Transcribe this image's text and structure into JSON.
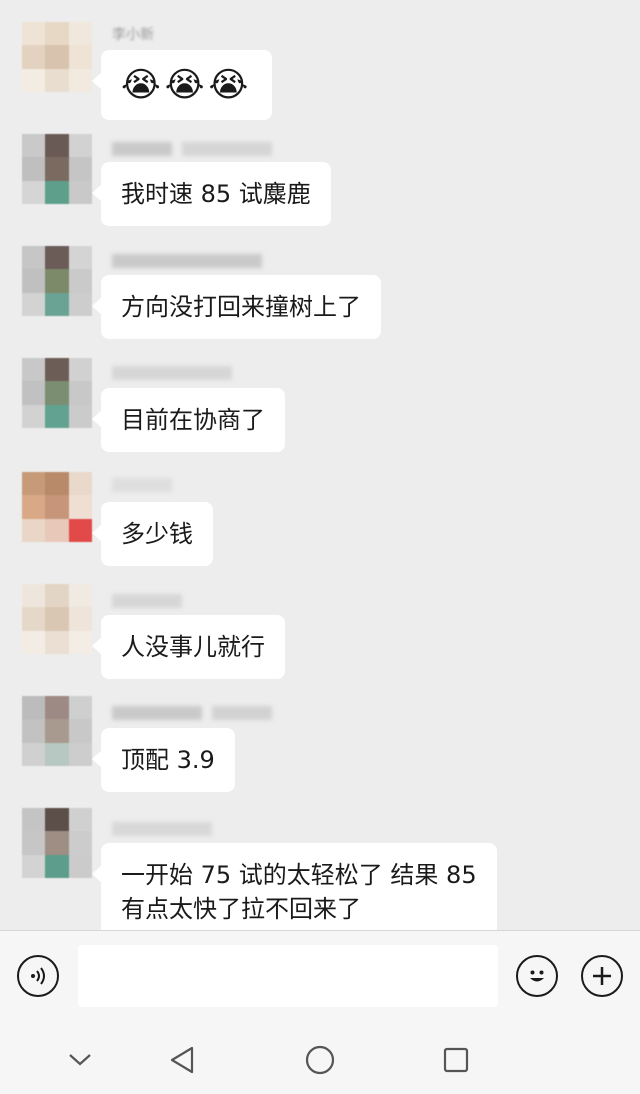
{
  "messages": [
    {
      "sender": "李小新",
      "text": "😭😭😭",
      "emoji": true
    },
    {
      "sender": "（短视频变现）",
      "text": "我时速 85 试麋鹿"
    },
    {
      "sender": "",
      "text": "方向没打回来撞树上了"
    },
    {
      "sender": "（短视频变现）",
      "text": "目前在协商了"
    },
    {
      "sender": "",
      "text": "多少钱"
    },
    {
      "sender": "",
      "text": "人没事儿就行"
    },
    {
      "sender": "（短视频变现）",
      "text": "顶配 3.9"
    },
    {
      "sender": "（短视频变现）",
      "text": "一开始 75 试的太轻松了 结果 85\n有点太快了拉不回来了"
    }
  ],
  "composer": {
    "voice_icon": "voice-icon",
    "input_value": "",
    "emoji_icon": "emoji-icon",
    "plus_icon": "plus-icon"
  },
  "navbar": {
    "icons": [
      "chevron-down-icon",
      "back-triangle-icon",
      "home-circle-icon",
      "recents-square-icon"
    ]
  }
}
